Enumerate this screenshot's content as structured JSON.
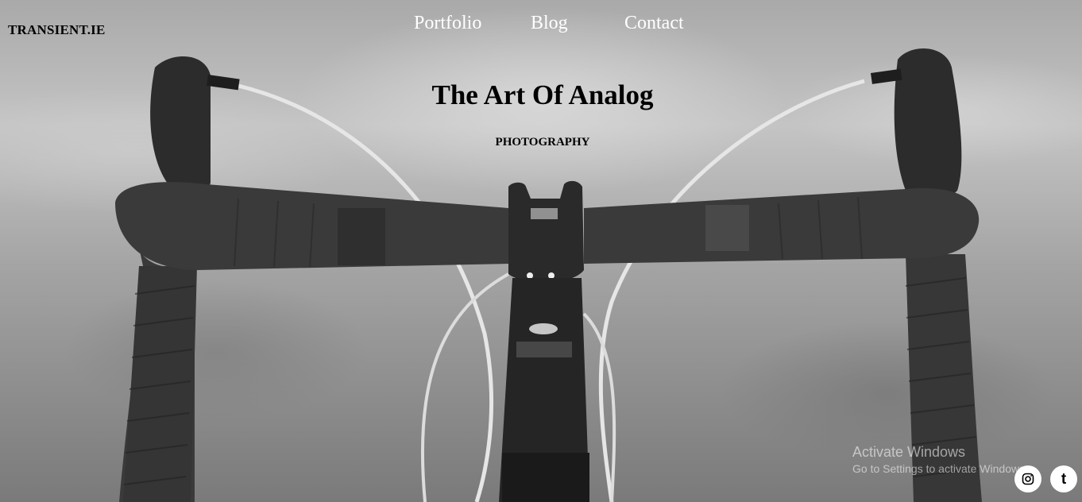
{
  "header": {
    "brand": "TRANSIENT.IE"
  },
  "nav": {
    "items": [
      {
        "label": "Portfolio"
      },
      {
        "label": "Blog"
      },
      {
        "label": "Contact"
      }
    ]
  },
  "hero": {
    "title": "The Art Of Analog",
    "subtitle": "PHOTOGRAPHY",
    "image_icon": "bicycle-handlebar-photo"
  },
  "watermark": {
    "line1": "Activate Windows",
    "line2": "Go to Settings to activate Windows."
  },
  "social": {
    "instagram_icon": "instagram-icon",
    "tumblr_icon": "tumblr-icon",
    "tumblr_glyph": "t"
  },
  "colors": {
    "nav_text": "#ffffff",
    "title_text": "#000000",
    "social_bg": "#ffffff"
  }
}
